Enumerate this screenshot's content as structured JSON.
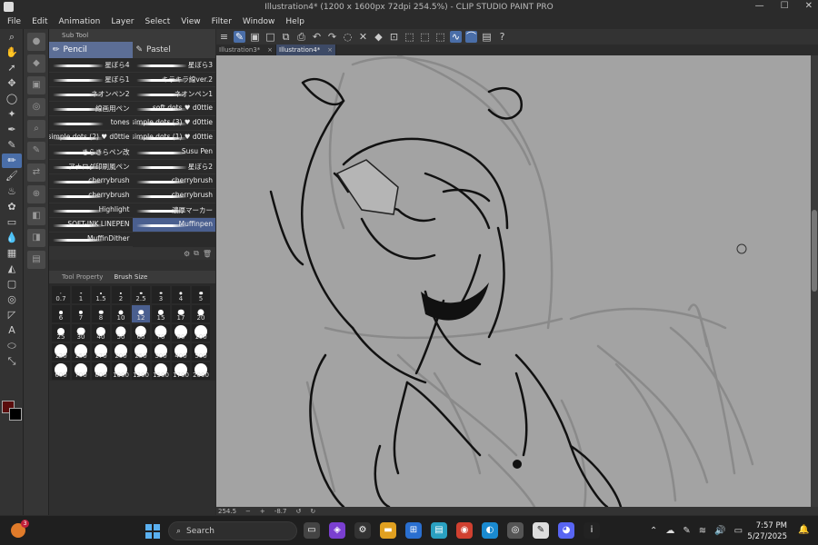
{
  "window": {
    "title": "Illustration4* (1200 x 1600px 72dpi 254.5%) - CLIP STUDIO PAINT PRO",
    "minimize": "—",
    "maximize": "☐",
    "close": "✕"
  },
  "menu": [
    "File",
    "Edit",
    "Animation",
    "Layer",
    "Select",
    "View",
    "Filter",
    "Window",
    "Help"
  ],
  "subtool_panel": {
    "header": "Sub Tool",
    "tabs": [
      "Pencil",
      "Pastel"
    ],
    "brushes": [
      "星ぼら4",
      "星ぼら3",
      "星ぼら1",
      "キラキラ線ver.2",
      "ネオンペン2",
      "ネオンペン1",
      "線画用ペン",
      "soft dots ♥ d0ttie",
      "tones",
      "simple dots (3) ♥ d0ttie",
      "simple dots (2) ♥ d0ttie",
      "simple dots (1) ♥ d0ttie",
      "きらきらペン改",
      "Susu Pen",
      "アナログ印刷風ペン",
      "星ぼら2",
      "cherrybrush",
      "cherrybrush",
      "cherrybrush",
      "cherrybrush",
      "Highlight",
      "濃厚マーカー",
      "SOFT-INK LINEPEN",
      "Muffinpen",
      "MuffinDither"
    ],
    "selected_brush_index": 23
  },
  "brush_size_panel": {
    "tabs": [
      "Tool Property",
      "Brush Size"
    ],
    "sizes": [
      "0.7",
      "1",
      "1.5",
      "2",
      "2.5",
      "3",
      "4",
      "5",
      "6",
      "7",
      "8",
      "10",
      "12",
      "15",
      "17",
      "20",
      "25",
      "30",
      "40",
      "50",
      "60",
      "70",
      "80",
      "100",
      "120",
      "150",
      "170",
      "200",
      "250",
      "300",
      "400",
      "500",
      "600",
      "700",
      "800",
      "1000",
      "1200",
      "1500",
      "1700",
      "2000"
    ],
    "selected_size": "12"
  },
  "document_tabs": [
    "Illustration3*",
    "Illustration4*"
  ],
  "active_tab_index": 1,
  "status": {
    "zoom": "254.5",
    "angle": "-8.7"
  },
  "taskbar": {
    "search_placeholder": "Search",
    "weather_badge": "3",
    "time": "7:57 PM",
    "date": "5/27/2025"
  },
  "colors": {
    "main": "#5a0d0d",
    "sub": "#000000",
    "accent": "#4a6ea8",
    "canvas": "#a3a3a3"
  }
}
